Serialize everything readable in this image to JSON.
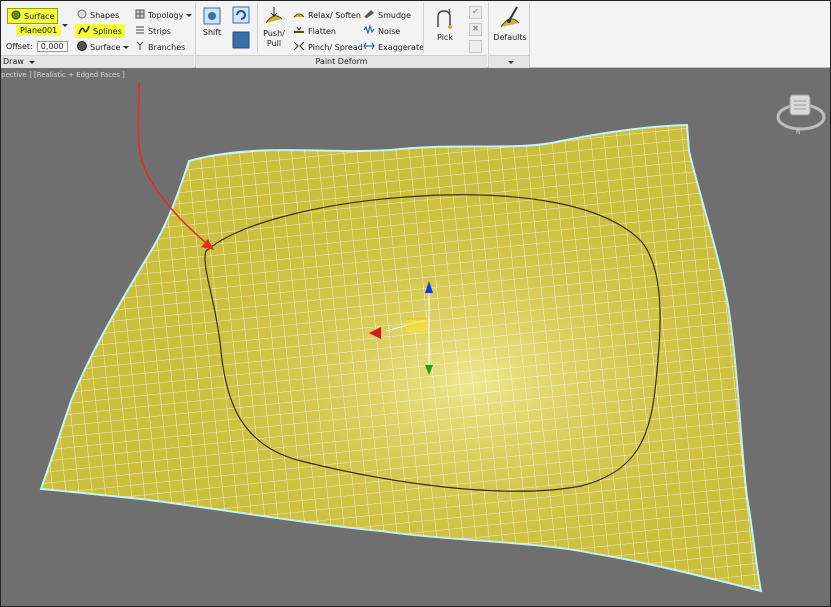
{
  "ribbon": {
    "surface_btn": "Surface",
    "object_name": "Plane001",
    "offset_label": "Offset:",
    "offset_value": "0,000",
    "draw_panel": "Draw",
    "shapes": "Shapes",
    "splines": "Splines",
    "surface": "Surface",
    "topology": "Topology",
    "strips": "Strips",
    "branches": "Branches",
    "shift": "Shift",
    "push": "Push/",
    "pull": "Pull",
    "relax": "Relax/ Soften",
    "flatten": "Flatten",
    "pinch": "Pinch/ Spread",
    "smudge": "Smudge",
    "noise": "Noise",
    "exaggerate": "Exaggerate",
    "pick": "Pick",
    "defaults": "Defaults",
    "paint_deform_panel": "Paint Deform"
  },
  "viewport": {
    "label": "pective ] [Realistic + Edged Faces ]"
  },
  "colors": {
    "mesh_fill": "#cdbf3e",
    "mesh_line": "#ffffff",
    "mesh_outline": "#bff4f4",
    "annotation": "#e52c1f",
    "highlight": "#f5ff3a"
  },
  "icons": [
    "surface-icon",
    "shapes-icon",
    "splines-icon",
    "surface-sphere-icon",
    "topology-icon",
    "strips-icon",
    "branches-icon",
    "shift-icon",
    "push-pull-icon",
    "relax-icon",
    "flatten-icon",
    "pinch-icon",
    "smudge-icon",
    "noise-icon",
    "exaggerate-icon",
    "pick-icon",
    "defaults-icon",
    "viewcube-icon",
    "gizmo-icon"
  ]
}
